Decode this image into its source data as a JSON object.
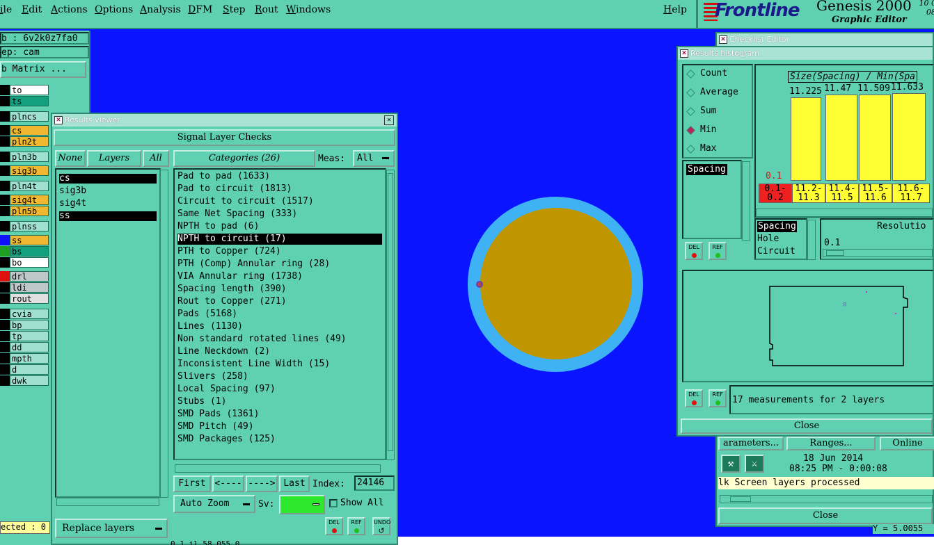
{
  "menu": [
    "ile",
    "Edit",
    "Actions",
    "Options",
    "Analysis",
    "DFM",
    "Step",
    "Rout",
    "Windows",
    "Help"
  ],
  "logo": {
    "brand": "Frontline",
    "product": "Genesis 2000",
    "subtitle": "Graphic Editor",
    "clock_top": "10 0",
    "clock_bottom": "08"
  },
  "left": {
    "job": "b : 6v2k0z7fa0",
    "step": "ep: cam",
    "matrix_button": "b Matrix ...",
    "layers": [
      {
        "name": "to",
        "bg": "#ffffff"
      },
      {
        "name": "ts",
        "bg": "#12a07e"
      },
      {
        "name": "plncs",
        "bg": "#a0e0d0"
      },
      {
        "name": "cs",
        "bg": "#f0b830"
      },
      {
        "name": "pln2t",
        "bg": "#f0b830"
      },
      {
        "name": "pln3b",
        "bg": "#a0e0d0"
      },
      {
        "name": "sig3b",
        "bg": "#f0b830"
      },
      {
        "name": "pln4t",
        "bg": "#a0e0d0"
      },
      {
        "name": "sig4t",
        "bg": "#f0b830"
      },
      {
        "name": "pln5b",
        "bg": "#f0b830"
      },
      {
        "name": "plnss",
        "bg": "#a0e0d0"
      },
      {
        "name": "ss",
        "bg": "#f0b830"
      },
      {
        "name": "bs",
        "bg": "#12a07e"
      },
      {
        "name": "bo",
        "bg": "#ffffff"
      },
      {
        "name": "drl",
        "bg": "#bfc8c8"
      },
      {
        "name": "ldi",
        "bg": "#bfc8c8"
      },
      {
        "name": "rout",
        "bg": "#e0e0e0"
      },
      {
        "name": "cvia",
        "bg": "#a0e0d0"
      },
      {
        "name": "bp",
        "bg": "#a0e0d0"
      },
      {
        "name": "tp",
        "bg": "#a0e0d0"
      },
      {
        "name": "dd",
        "bg": "#a0e0d0"
      },
      {
        "name": "mpth",
        "bg": "#a0e0d0"
      },
      {
        "name": "d",
        "bg": "#a0e0d0"
      },
      {
        "name": "dwk",
        "bg": "#a0e0d0"
      }
    ],
    "selected": "ected : 0"
  },
  "results_viewer": {
    "title": "Results viewer",
    "header": "Signal Layer Checks",
    "none_btn": "None",
    "layers_btn": "Layers",
    "all_btn": "All",
    "layers": [
      "cs",
      "sig3b",
      "sig4t",
      "ss"
    ],
    "categories_btn": "Categories (26)",
    "meas_label": "Meas:",
    "meas_value": "All",
    "categories": [
      "Pad to pad (1633)",
      "Pad to circuit (1813)",
      "Circuit to circuit (1517)",
      "Same Net Spacing (333)",
      "NPTH to pad (6)",
      "NPTH to circuit (17)",
      "PTH to Copper (724)",
      "PTH (Comp) Annular ring (28)",
      "VIA Annular ring (1738)",
      "Spacing length (390)",
      "Rout to Copper (271)",
      "Pads (5168)",
      "Lines (1130)",
      "Non standard rotated lines (49)",
      "Line Neckdown (2)",
      "Inconsistent Line Width (15)",
      "Slivers (258)",
      "Local Spacing (97)",
      "Stubs (1)",
      "SMD Pads (1361)",
      "SMD Pitch (49)",
      "SMD Packages (125)"
    ],
    "first_btn": "First",
    "prev_btn": "<----",
    "next_btn": "---->",
    "last_btn": "Last",
    "index_label": "Index:",
    "index_value": "24146",
    "auto_zoom": "Auto Zoom",
    "sv_label": "Sv:",
    "show_all": "Show All",
    "replace_layers": "Replace layers",
    "del": "DEL",
    "ref": "REF",
    "undo": "UNDO",
    "status": "0.1 il   58.055   0"
  },
  "checklist_editor": {
    "title": "Checklist Editor"
  },
  "histogram": {
    "title": "Results histogram",
    "modes": [
      "Count",
      "Average",
      "Sum",
      "Min",
      "Max"
    ],
    "selected_mode": "Min",
    "measure_list": [
      "Spacing"
    ],
    "chart_title": "Size(Spacing) / Min(Spa",
    "low_label": "0.1",
    "bar_labels": [
      "11.225",
      "11.47",
      "11.509",
      "11.633"
    ],
    "bins": [
      "0.1-\n0.2",
      "11.2-\n11.3",
      "11.4-\n11.5",
      "11.5-\n11.6",
      "11.6-\n11.7"
    ],
    "filter_items": [
      "Spacing",
      "Hole",
      "Circuit"
    ],
    "resolution_label": "Resolutio",
    "resolution_value": "0.1",
    "summary": "17 measurements for 2 layers",
    "close": "Close",
    "del": "DEL",
    "ref": "REF"
  },
  "checklist_lower": {
    "params_btn": "arameters...",
    "ranges_btn": "Ranges...",
    "online_btn": "Online",
    "date": "18 Jun 2014",
    "time": "08:25 PM - 0:00:08",
    "message": "lk Screen layers processed",
    "close": "Close",
    "coord": "Y = 5.0055"
  }
}
